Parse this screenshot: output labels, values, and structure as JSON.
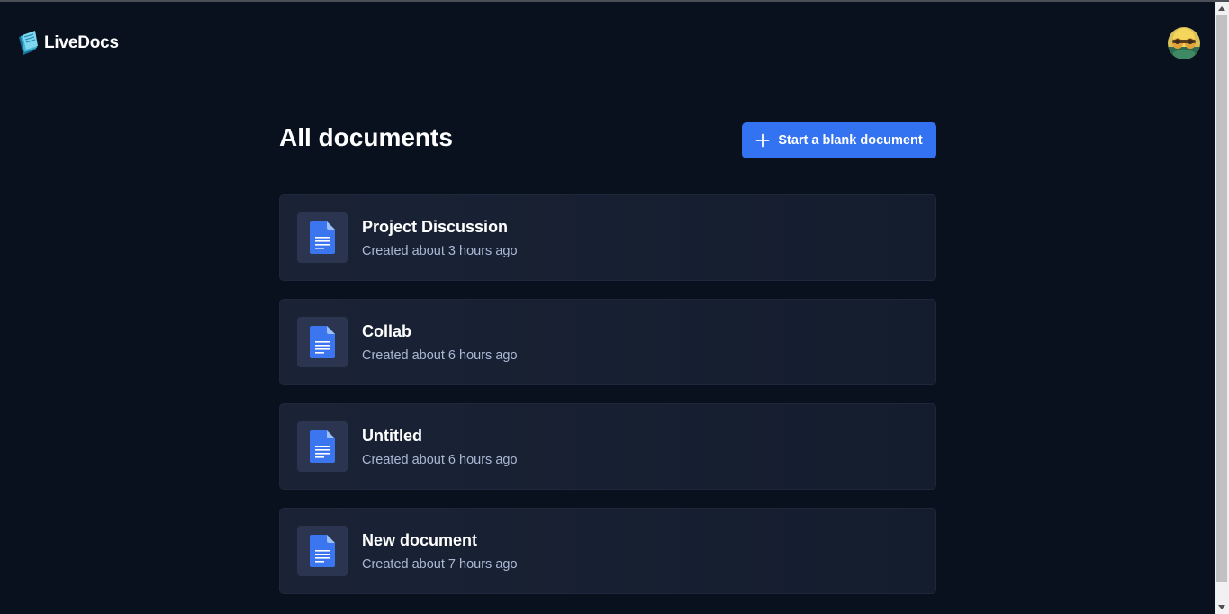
{
  "app": {
    "name": "LiveDocs"
  },
  "header": {
    "logo_icon": "livedocs-logo-icon",
    "avatar_icon": "user-avatar"
  },
  "main": {
    "title": "All documents",
    "new_button": {
      "label": "Start a blank document",
      "icon": "plus-icon",
      "color": "#3372f1"
    }
  },
  "documents": [
    {
      "title": "Project Discussion",
      "created": "Created about 3 hours ago",
      "icon": "document-icon"
    },
    {
      "title": "Collab",
      "created": "Created about 6 hours ago",
      "icon": "document-icon"
    },
    {
      "title": "Untitled",
      "created": "Created about 6 hours ago",
      "icon": "document-icon"
    },
    {
      "title": "New document",
      "created": "Created about 7 hours ago",
      "icon": "document-icon"
    }
  ],
  "colors": {
    "background": "#09111f",
    "card": "#1a2335",
    "accent": "#3372f1",
    "subtext": "#abb8d6"
  }
}
